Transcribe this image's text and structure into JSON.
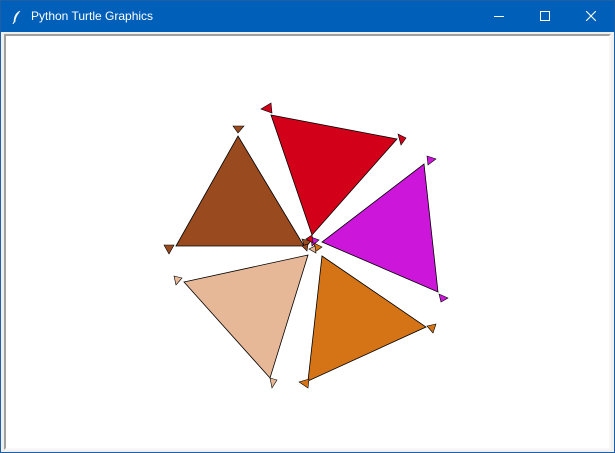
{
  "window": {
    "title": "Python Turtle Graphics",
    "icon": "feather-icon",
    "controls": [
      "minimize-icon",
      "maximize-icon",
      "close-icon"
    ]
  },
  "canvas": {
    "background": "#ffffff",
    "outline": "#000000",
    "shapes": [
      {
        "name": "triangle-red",
        "fill": "#d3001a"
      },
      {
        "name": "triangle-magenta",
        "fill": "#cc17db"
      },
      {
        "name": "triangle-orange",
        "fill": "#d47416"
      },
      {
        "name": "triangle-peach",
        "fill": "#e7b898"
      },
      {
        "name": "triangle-brown",
        "fill": "#9a4a1f"
      }
    ]
  }
}
